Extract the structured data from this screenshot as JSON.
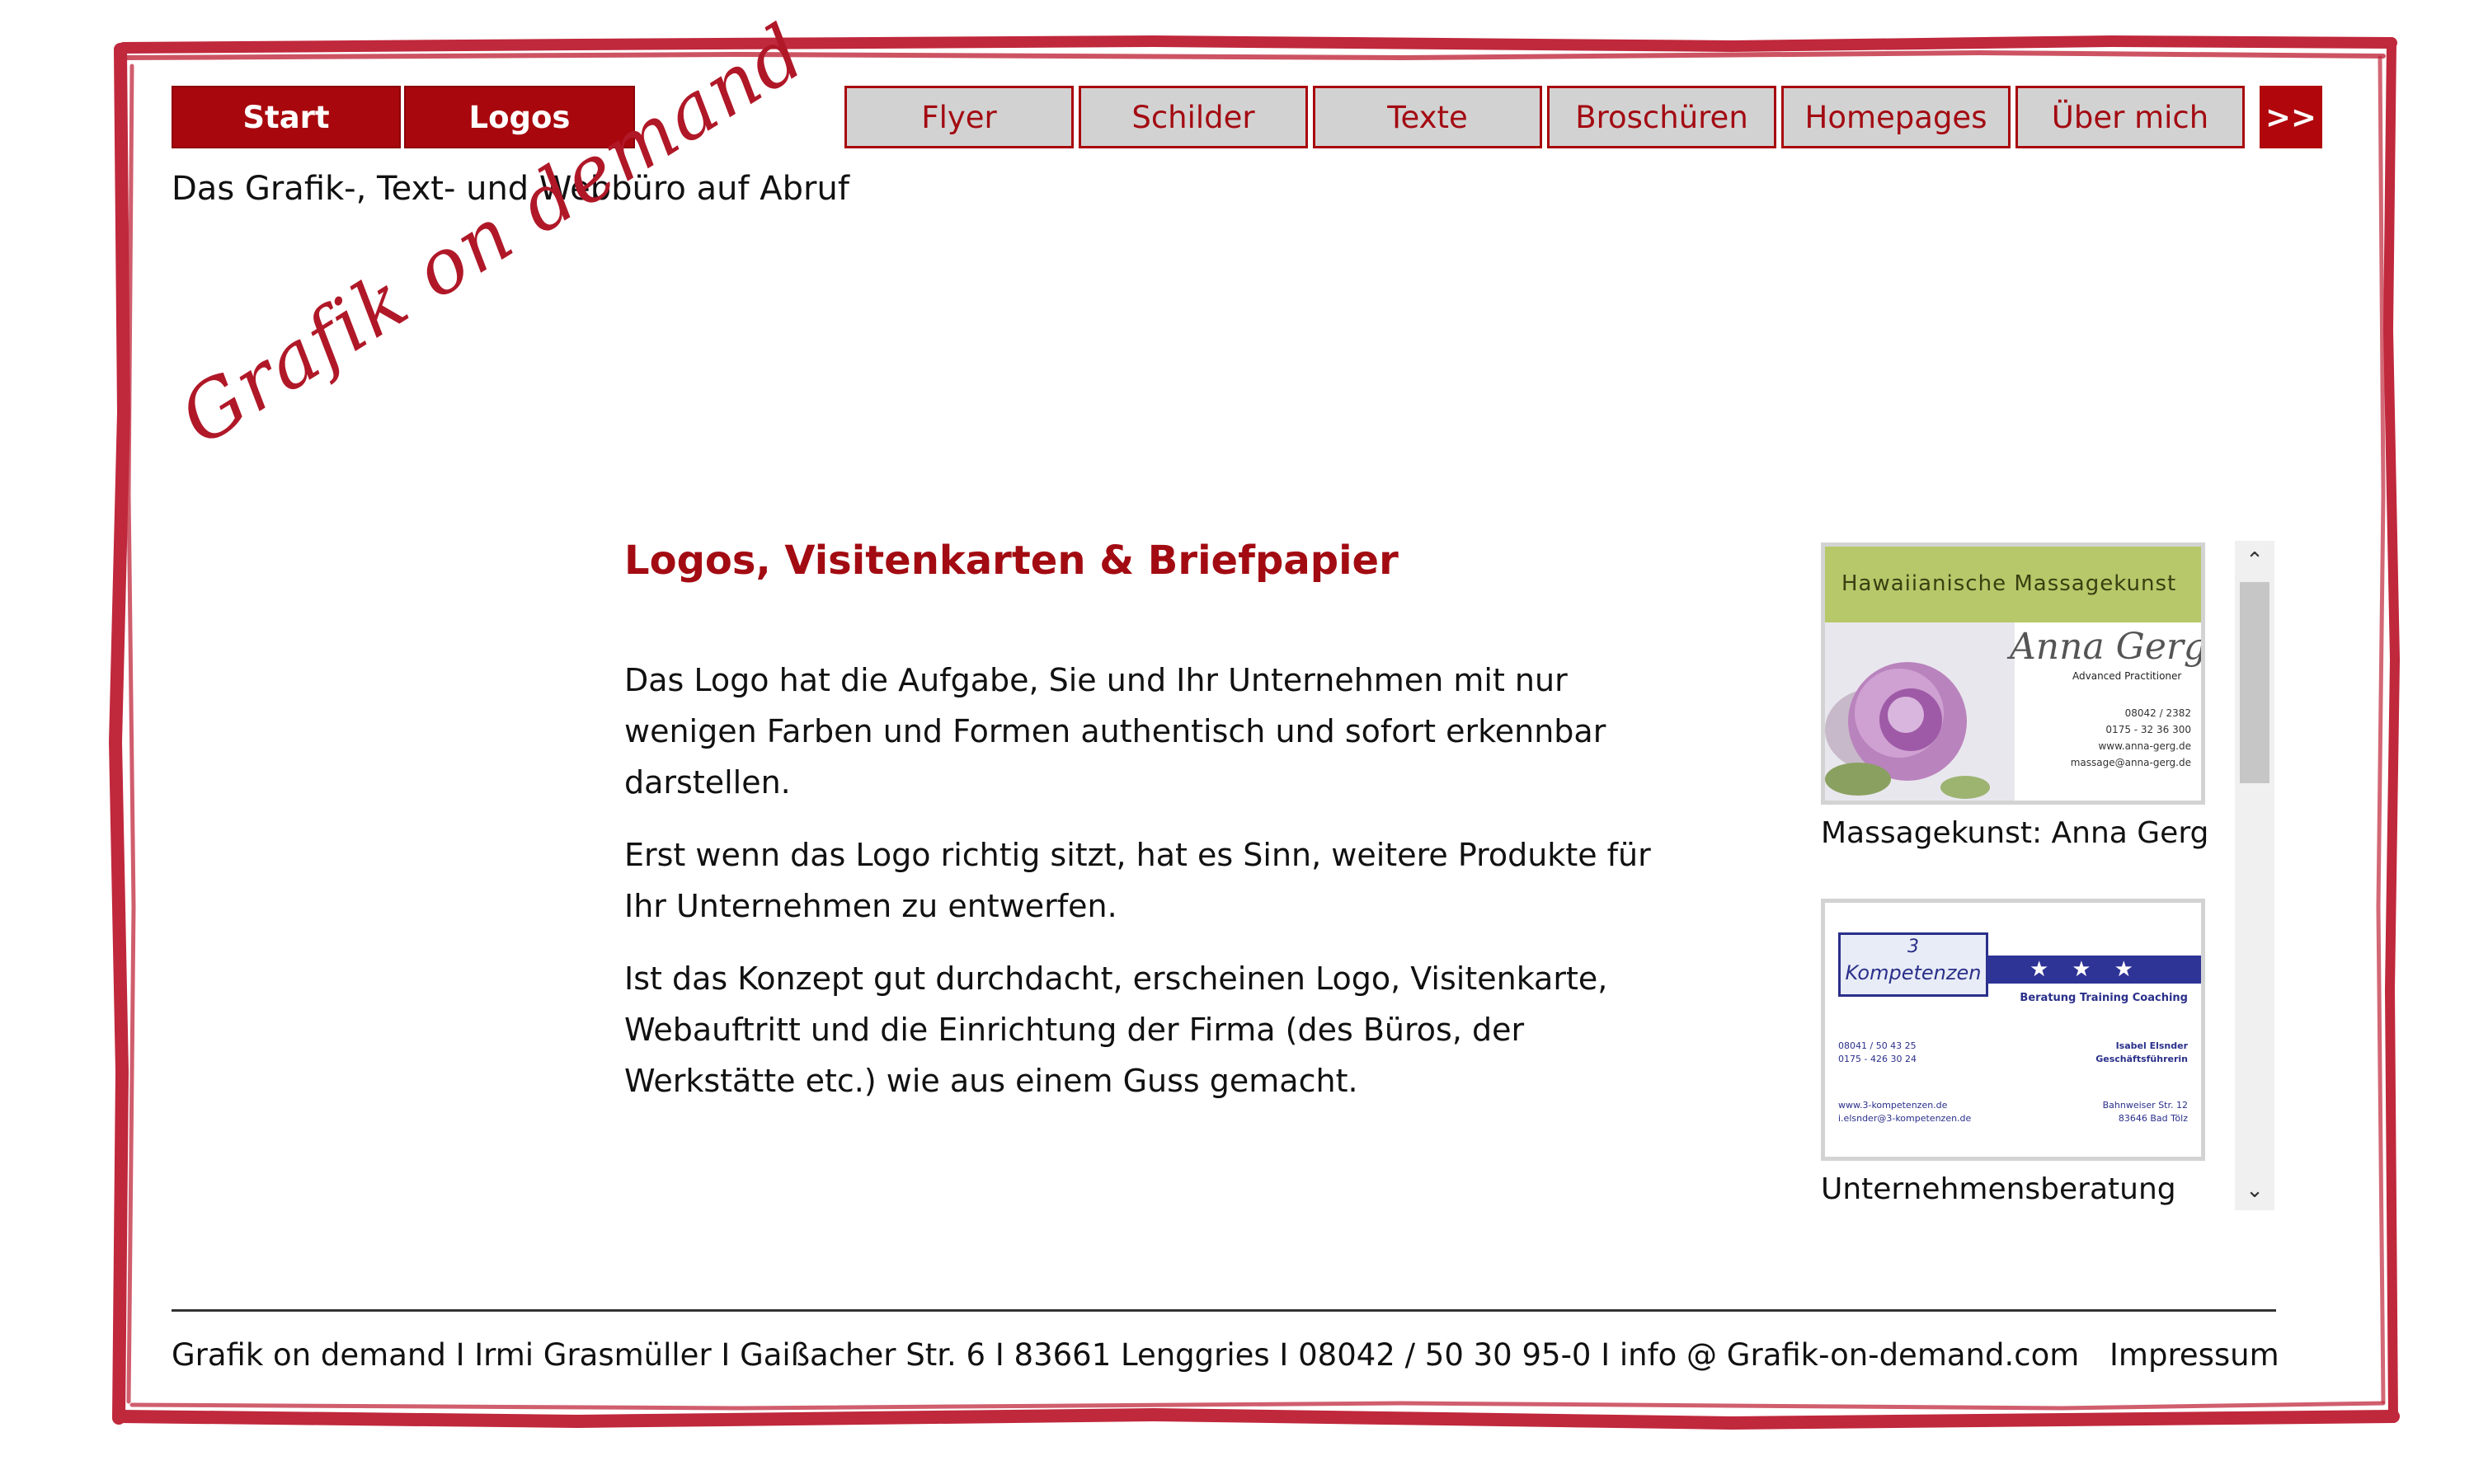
{
  "nav": {
    "primary": [
      {
        "label": "Start",
        "active": true
      },
      {
        "label": "Logos",
        "active": true
      }
    ],
    "secondary": [
      {
        "label": "Flyer"
      },
      {
        "label": "Schilder"
      },
      {
        "label": "Texte"
      },
      {
        "label": "Broschüren"
      },
      {
        "label": "Homepages"
      },
      {
        "label": "Über mich"
      }
    ],
    "more_label": ">>"
  },
  "tagline": "Das Grafik-, Text- und Webbüro auf Abruf",
  "logo_script": "Grafik on demand",
  "main": {
    "heading": "Logos, Visitenkarten & Briefpapier",
    "paragraphs": [
      "Das Logo hat die Aufgabe, Sie und Ihr Unternehmen mit nur wenigen Farben und Formen authentisch und sofort erkennbar darstellen.",
      "Erst wenn das Logo richtig sitzt, hat es Sinn, weitere Produkte für Ihr Unternehmen zu entwerfen.",
      "Ist das Konzept gut durchdacht, erscheinen Logo, Visitenkarte, Webauftritt und die Einrichtung der Firma (des Büros, der Werkstätte etc.) wie aus einem Guss gemacht."
    ]
  },
  "gallery": {
    "items": [
      {
        "caption": "Massagekunst: Anna Gerg",
        "card": {
          "title": "Hawaiianische Massagekunst",
          "name": "Anna Gerg",
          "subtitle": "Advanced Practitioner",
          "lines": [
            "08042 / 2382",
            "0175 - 32 36 300",
            "www.anna-gerg.de",
            "massage@anna-gerg.de"
          ]
        }
      },
      {
        "caption": "Unternehmensberatung",
        "card": {
          "number": "3",
          "word": "Kompetenzen",
          "stars": "★★★",
          "tagline": "Beratung Training Coaching",
          "left_lines": [
            "08041 / 50 43 25",
            "0175 - 426 30 24"
          ],
          "right_lines": [
            "Isabel Elsnder",
            "Geschäftsführerin"
          ],
          "web_lines": [
            "www.3-kompetenzen.de",
            "i.elsnder@3-kompetenzen.de"
          ],
          "address_lines": [
            "Bahnweiser Str. 12",
            "83646 Bad Tölz"
          ]
        }
      }
    ],
    "scroll_up": "⌃",
    "scroll_down": "⌄"
  },
  "footer": {
    "text": "Grafik on demand  I  Irmi Grasmüller  I  Gaißacher Str. 6  I  83661 Lenggries  I  08042 / 50 30 95-0  I  info @ Grafik-on-demand.com",
    "impressum": "Impressum"
  },
  "colors": {
    "accent": "#a8070d",
    "frame": "#c0283c",
    "inactive_bg": "#d2d2d2"
  }
}
